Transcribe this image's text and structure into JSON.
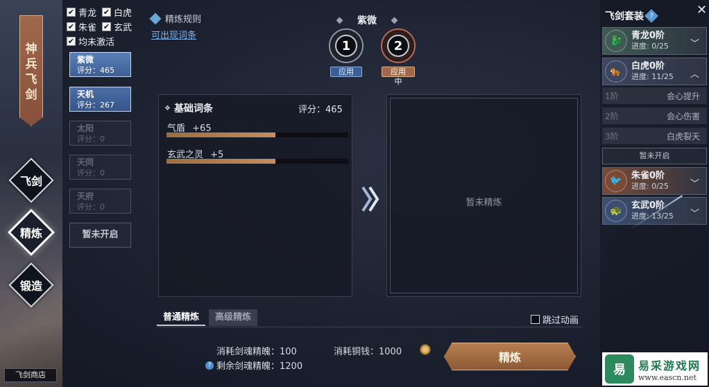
{
  "left_rail": {
    "banner": [
      "神",
      "兵",
      "飞",
      "剑"
    ],
    "nav": [
      {
        "label": "飞剑",
        "active": false
      },
      {
        "label": "精炼",
        "active": true
      },
      {
        "label": "锻造",
        "active": false
      }
    ],
    "shop_label": "飞剑商店"
  },
  "filters": {
    "row1": [
      {
        "label": "青龙",
        "checked": true
      },
      {
        "label": "白虎",
        "checked": true
      }
    ],
    "row2": [
      {
        "label": "朱雀",
        "checked": true
      },
      {
        "label": "玄武",
        "checked": true
      }
    ],
    "row3": [
      {
        "label": "均未激活",
        "checked": true
      }
    ]
  },
  "plans": [
    {
      "name": "紫微",
      "score": "评分：465",
      "state": "selected"
    },
    {
      "name": "天机",
      "score": "评分：267",
      "state": "active"
    },
    {
      "name": "太阳",
      "score": "评分：0",
      "state": "disabled"
    },
    {
      "name": "天同",
      "score": "评分：0",
      "state": "disabled"
    },
    {
      "name": "天府",
      "score": "评分：0",
      "state": "disabled"
    }
  ],
  "plan_locked": "暂未开启",
  "rules": {
    "title": "精炼规则",
    "link": "可出现词条"
  },
  "current_plan_title": "紫微",
  "slots": [
    {
      "number": "1",
      "tag": "应用",
      "active": false
    },
    {
      "number": "2",
      "tag": "应用中",
      "active": true
    }
  ],
  "base_stats": {
    "title": "基础词条",
    "score": "评分：465",
    "items": [
      {
        "label": "气盾",
        "value": "+65",
        "fill": 0.6
      },
      {
        "label": "玄武之灵",
        "value": "+5",
        "fill": 0.6
      }
    ]
  },
  "arrow_icon": "double-chevron-right",
  "result_placeholder": "暂未精炼",
  "tabs": [
    {
      "label": "普通精炼",
      "active": true
    },
    {
      "label": "高级精炼",
      "active": false
    }
  ],
  "skip_animation": "跳过动画",
  "costs": {
    "soul_cost": "消耗剑魂精魄：100",
    "soul_remaining": "剩余剑魂精魄：1200",
    "copper_cost": "消耗铜钱：1000"
  },
  "refine_button": "精炼",
  "sets": {
    "title": "飞剑套装",
    "cards": [
      {
        "name": "青龙0阶",
        "progress": "进度: 0/25",
        "emblem": "🐉",
        "color": "#3f5a52",
        "expanded": false
      },
      {
        "name": "白虎0阶",
        "progress": "进度: 11/25",
        "emblem": "🐅",
        "color": "#3d4660",
        "expanded": true
      },
      {
        "name": "朱雀0阶",
        "progress": "进度: 0/25",
        "emblem": "🐦",
        "color": "#7a4a36",
        "expanded": false
      },
      {
        "name": "玄武0阶",
        "progress": "进度: 13/25",
        "emblem": "🐢",
        "color": "#3c4e72",
        "expanded": false
      }
    ],
    "tiers": [
      {
        "tier": "1阶",
        "effect": "会心提升"
      },
      {
        "tier": "2阶",
        "effect": "会心伤害"
      },
      {
        "tier": "3阶",
        "effect": "白虎裂天"
      }
    ],
    "locked": "暂未开启"
  },
  "logo": {
    "title": "易采游戏网",
    "url": "www.eascn.net"
  },
  "colors": {
    "accent_bronze": "#b87f4f",
    "plan_selected": "#5a7fb8"
  }
}
